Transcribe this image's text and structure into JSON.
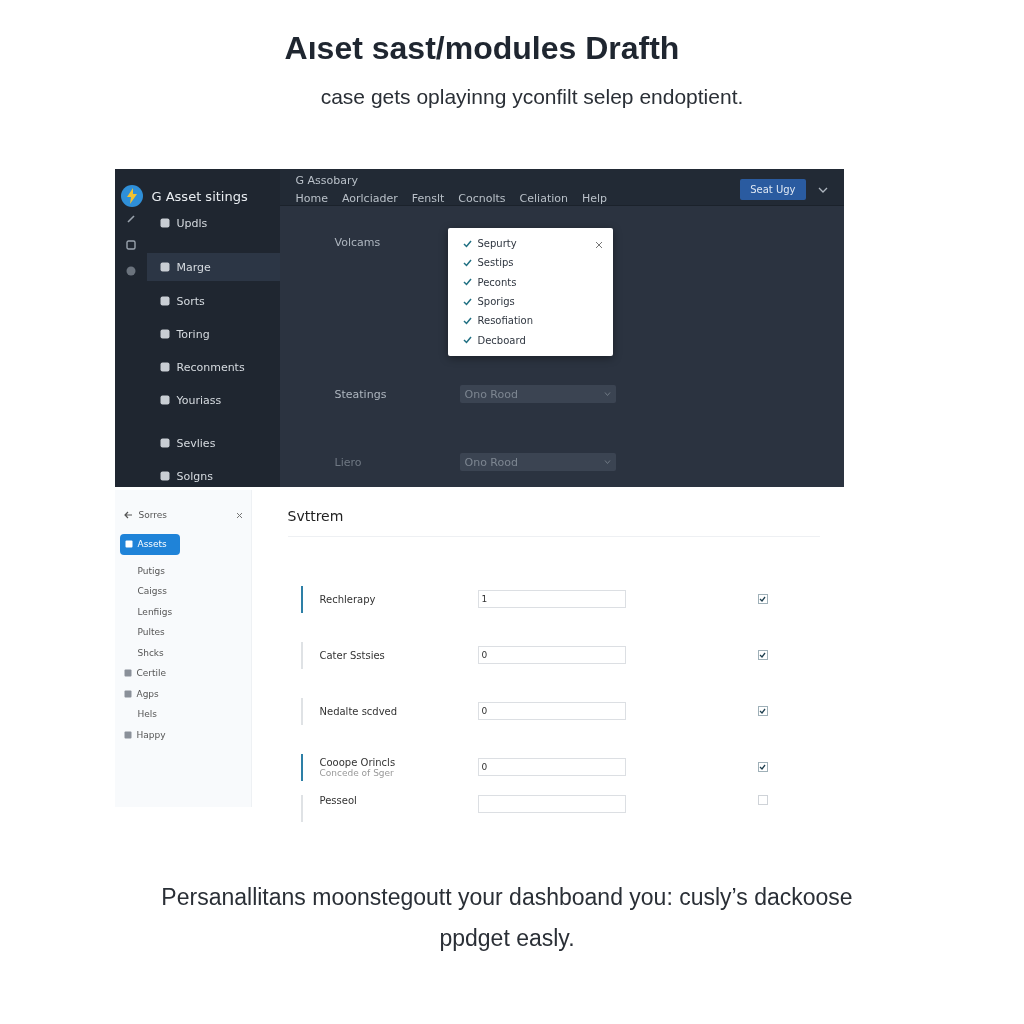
{
  "headline": "Aıset sast/modules Drafth",
  "subtitle": "case gets oplayinng yconfilt selep endoptient.",
  "dark_app": {
    "app_name": "G Asset sitings",
    "section_title": "G Assobary",
    "sidebar": {
      "items": [
        {
          "label": "Updls",
          "selected": false
        },
        {
          "label": "Marge",
          "selected": true
        },
        {
          "label": "Sorts",
          "selected": false
        },
        {
          "label": "Toring",
          "selected": false
        },
        {
          "label": "Reconments",
          "selected": false
        },
        {
          "label": "Youriass",
          "selected": false
        },
        {
          "label": "Sevlies",
          "selected": false
        },
        {
          "label": "Solgns",
          "selected": false
        }
      ]
    },
    "nav": [
      "Home",
      "Aorlciader",
      "Fenslt",
      "Cocnolts",
      "Celiation",
      "Help"
    ],
    "primary_button": "Seat Ugy",
    "form": [
      {
        "label": "Volcams",
        "kind": "popup"
      },
      {
        "label": "Steatings",
        "kind": "dropdown",
        "value": "Ono Rood"
      },
      {
        "label": "Liero",
        "kind": "dropdown",
        "value": "Ono Rood"
      }
    ],
    "popup": {
      "items": [
        {
          "label": "Sepurty",
          "checked": true
        },
        {
          "label": "Sestips",
          "checked": true
        },
        {
          "label": "Peconts",
          "checked": true
        },
        {
          "label": "Sporigs",
          "checked": true
        },
        {
          "label": "Resofiation",
          "checked": true
        },
        {
          "label": "Decboard",
          "checked": true
        }
      ]
    }
  },
  "light_app": {
    "sidebar": {
      "title": "Sorres",
      "items": [
        {
          "label": "Assets",
          "selected": true,
          "icon": true
        },
        {
          "label": "Putigs",
          "selected": false,
          "icon": false
        },
        {
          "label": "Caigss",
          "selected": false,
          "icon": false
        },
        {
          "label": "Lenfiigs",
          "selected": false,
          "icon": false
        },
        {
          "label": "Pultes",
          "selected": false,
          "icon": false
        },
        {
          "label": "Shcks",
          "selected": false,
          "icon": false
        },
        {
          "label": "Certile",
          "selected": false,
          "icon": true
        },
        {
          "label": "Agps",
          "selected": false,
          "icon": true
        },
        {
          "label": "Hels",
          "selected": false,
          "icon": false
        },
        {
          "label": "Happy",
          "selected": false,
          "icon": true
        }
      ]
    },
    "heading": "Svttrem",
    "rows": [
      {
        "label": "Rechlerapy",
        "value": "1",
        "accent": true,
        "checked": true
      },
      {
        "label": "Cater Sstsies",
        "value": "0",
        "accent": false,
        "checked": true
      },
      {
        "label": "Nedalte scdved",
        "value": "0",
        "accent": false,
        "checked": true
      },
      {
        "label": "Cooope Orincls",
        "sublabel": "Concede of Sger",
        "value": "0",
        "accent": true,
        "checked": true
      },
      {
        "label": "Pesseol",
        "accent": false,
        "checked": false
      }
    ]
  },
  "footer_text": "Persanallitans moonstegoutt your dashboand you: cusly’s dackoose ppdget easly."
}
